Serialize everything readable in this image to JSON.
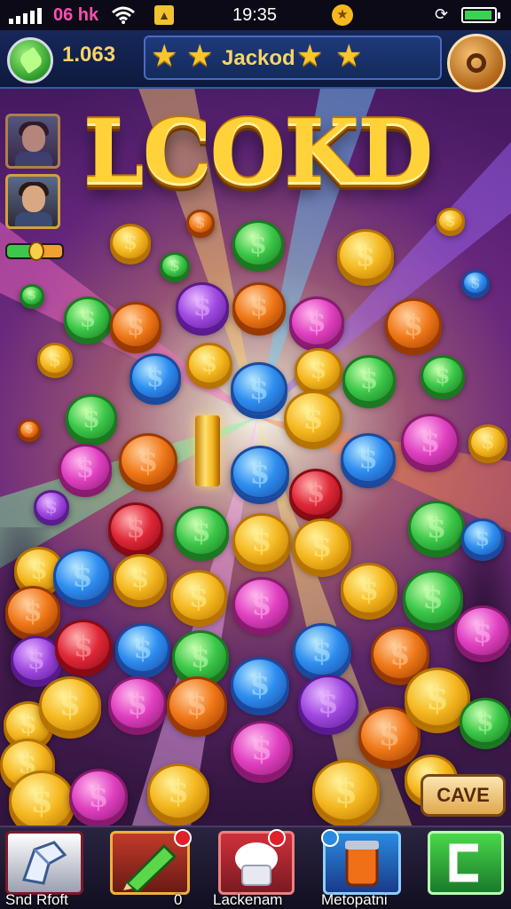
{
  "status_bar": {
    "carrier": "06 hk",
    "time": "19:35",
    "icons": [
      "signal-icon",
      "wifi-icon",
      "notification-icon",
      "coin-status-icon",
      "rotation-icon",
      "battery-icon"
    ]
  },
  "top_hud": {
    "coins": "1.063",
    "title": "Jackod",
    "star_count": 4,
    "icons": [
      "gem-icon",
      "star-icon",
      "menu-ring-icon"
    ]
  },
  "logo": {
    "text": "LCOKD"
  },
  "side": {
    "icons": [
      "player-portrait",
      "player-avatar",
      "level-heart-icon"
    ]
  },
  "save_button": {
    "label": "CAVE"
  },
  "bottom_bar": {
    "tabs": [
      {
        "label": "Snd Rfoft",
        "icon": "shoe-icon"
      },
      {
        "label": "",
        "icon": "pencil-icon",
        "count": "0"
      },
      {
        "label": "Lackenam",
        "icon": "chef-hat-icon"
      },
      {
        "label": "Metopatni",
        "icon": "jar-icon"
      },
      {
        "label": "",
        "icon": "exit-icon"
      }
    ]
  },
  "colors": {
    "gold": "#f5b820",
    "green": "#3cc84a",
    "blue": "#2e8ef0",
    "purple": "#a048e0",
    "pink": "#e040c0",
    "red": "#e02838",
    "orange": "#f07818",
    "hud_blue": "#16285a"
  }
}
